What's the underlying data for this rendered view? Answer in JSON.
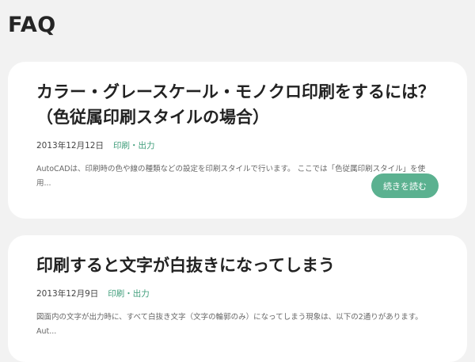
{
  "page": {
    "title": "FAQ"
  },
  "articles": [
    {
      "title": "カラー・グレースケール・モノクロ印刷をするには？（色従属印刷スタイルの場合）",
      "date": "2013年12月12日",
      "category": "印刷・出力",
      "excerpt": "AutoCADは、印刷時の色や線の種類などの設定を印刷スタイルで行います。 ここでは「色従属印刷スタイル」を使用...",
      "read_more": "続きを読む"
    },
    {
      "title": "印刷すると文字が白抜きになってしまう",
      "date": "2013年12月9日",
      "category": "印刷・出力",
      "excerpt": "図面内の文字が出力時に、すべて白抜き文字（文字の輪郭のみ）になってしまう現象は、以下の2通りがあります。 Aut..."
    }
  ]
}
